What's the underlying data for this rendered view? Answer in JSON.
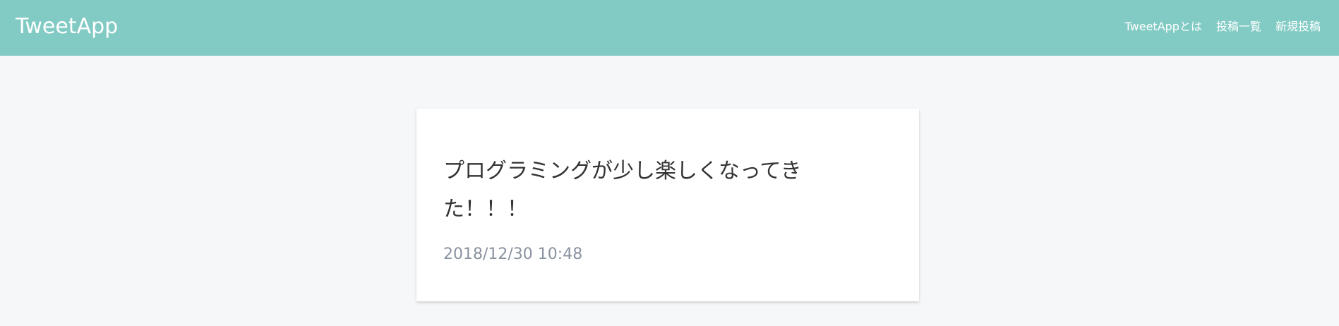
{
  "header": {
    "logo": "TweetApp",
    "nav": {
      "about": "TweetAppとは",
      "posts_index": "投稿一覧",
      "new_post": "新規投稿"
    }
  },
  "post": {
    "content": "プログラミングが少し楽しくなってきた！！！",
    "created_at": "2018/12/30 10:48"
  },
  "colors": {
    "header_bg": "#82cbc4",
    "page_bg": "#f6f7f9",
    "card_bg": "#ffffff",
    "timestamp": "#8a92a0"
  }
}
